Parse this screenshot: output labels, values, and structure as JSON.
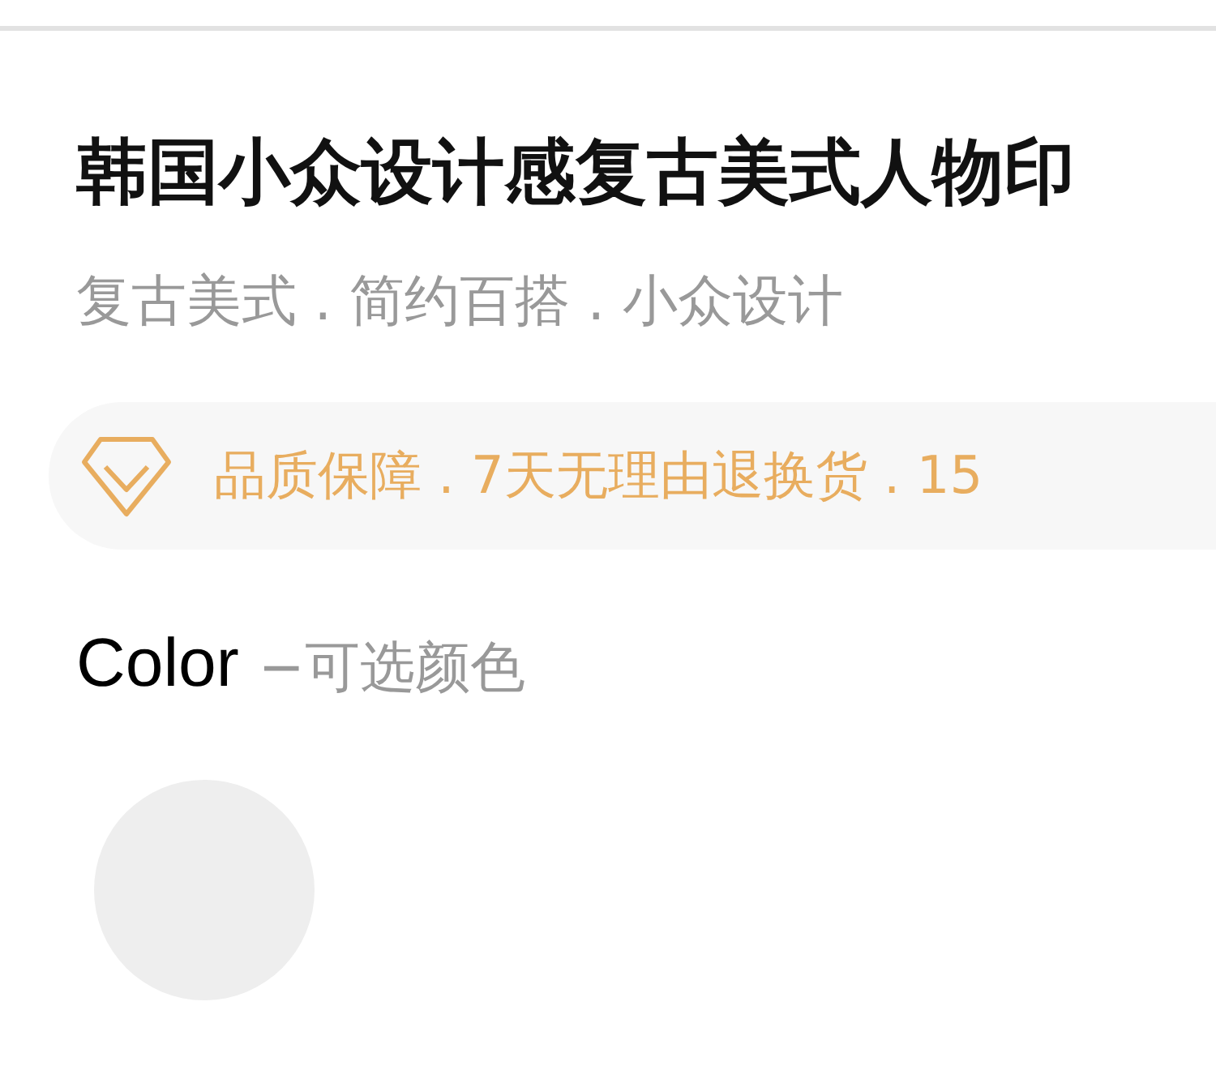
{
  "product": {
    "title": "韩国小众设计感复古美式人物印",
    "tagline": "复古美式 . 简约百搭 . 小众设计"
  },
  "guarantee": {
    "text": "品质保障 . 7天无理由退换货 . 15"
  },
  "color_section": {
    "label": "Color",
    "hint": "−可选颜色",
    "swatches": [
      {
        "color": "#eeeeee"
      }
    ]
  }
}
